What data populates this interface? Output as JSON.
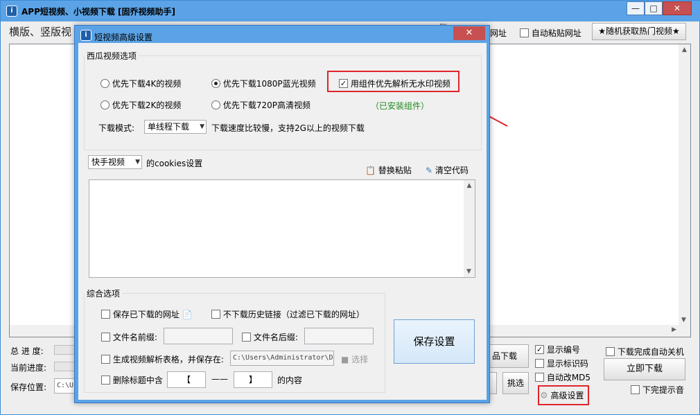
{
  "main": {
    "title": "APP短视频、小视频下载 [固乔视频助手]",
    "headline": "横版、竖版视",
    "headline_right_fragment": "侧",
    "paste_url_label": "网址",
    "auto_paste_label": "自动粘贴网址",
    "random_hot_button": "★随机获取热门视频★",
    "total_progress_label": "总 进 度:",
    "current_progress_label": "当前进度:",
    "save_location_label": "保存位置:",
    "save_location_value": "C:\\Us",
    "download_works_button": "品下载",
    "pick_button": "挑选",
    "show_number": {
      "label": "显示编号",
      "checked": true
    },
    "show_id": {
      "label": "显示标识码",
      "checked": false
    },
    "auto_md5": {
      "label": "自动改MD5",
      "checked": false
    },
    "advanced_settings_button": "高级设置",
    "auto_shutdown": {
      "label": "下载完成自动关机",
      "checked": false
    },
    "download_now_button": "立即下载",
    "done_sound": {
      "label": "下完提示音",
      "checked": false
    }
  },
  "dialog": {
    "title": "短视频高级设置",
    "close_glyph": "✕",
    "xigua": {
      "group_title": "西瓜视频选项",
      "options": [
        {
          "label": "优先下载4K的视频",
          "selected": false
        },
        {
          "label": "优先下载1080P蓝光视频",
          "selected": true
        },
        {
          "label": "优先下载2K的视频",
          "selected": false
        },
        {
          "label": "优先下载720P高清视频",
          "selected": false
        }
      ],
      "component_option": {
        "label": "用组件优先解析无水印视频",
        "checked": true
      },
      "component_status": "（已安装组件）",
      "download_mode_label": "下载模式:",
      "download_mode_value": "单线程下载",
      "download_mode_hint": "下载速度比较慢，支持2G以上的视频下载"
    },
    "cookies": {
      "platform_value": "快手视频",
      "cookies_label": "的cookies设置",
      "replace_paste_button": "替换粘贴",
      "clear_code_button": "清空代码",
      "text": ""
    },
    "general": {
      "group_title": "综合选项",
      "save_downloaded_url": {
        "label": "保存已下载的网址",
        "checked": false
      },
      "skip_history": {
        "label": "不下载历史链接（过滤已下载的网址）",
        "checked": false
      },
      "filename_prefix": {
        "label": "文件名前缀:",
        "checked": false,
        "value": ""
      },
      "filename_suffix": {
        "label": "文件名后缀:",
        "checked": false,
        "value": ""
      },
      "gen_table": {
        "label": "生成视频解析表格，并保存在:",
        "checked": false,
        "path": "C:\\Users\\Administrator\\De"
      },
      "choose_button": "选择",
      "delete_title": {
        "label": "删除标题中含",
        "checked": false,
        "open_bracket": "【",
        "separator": "——",
        "close_bracket": "】",
        "suffix": "的内容"
      },
      "save_settings_button": "保存设置"
    }
  },
  "colors": {
    "titlebar": "#5ba3e6",
    "highlight_red": "#e0242a",
    "status_green": "#1e8a1e"
  }
}
